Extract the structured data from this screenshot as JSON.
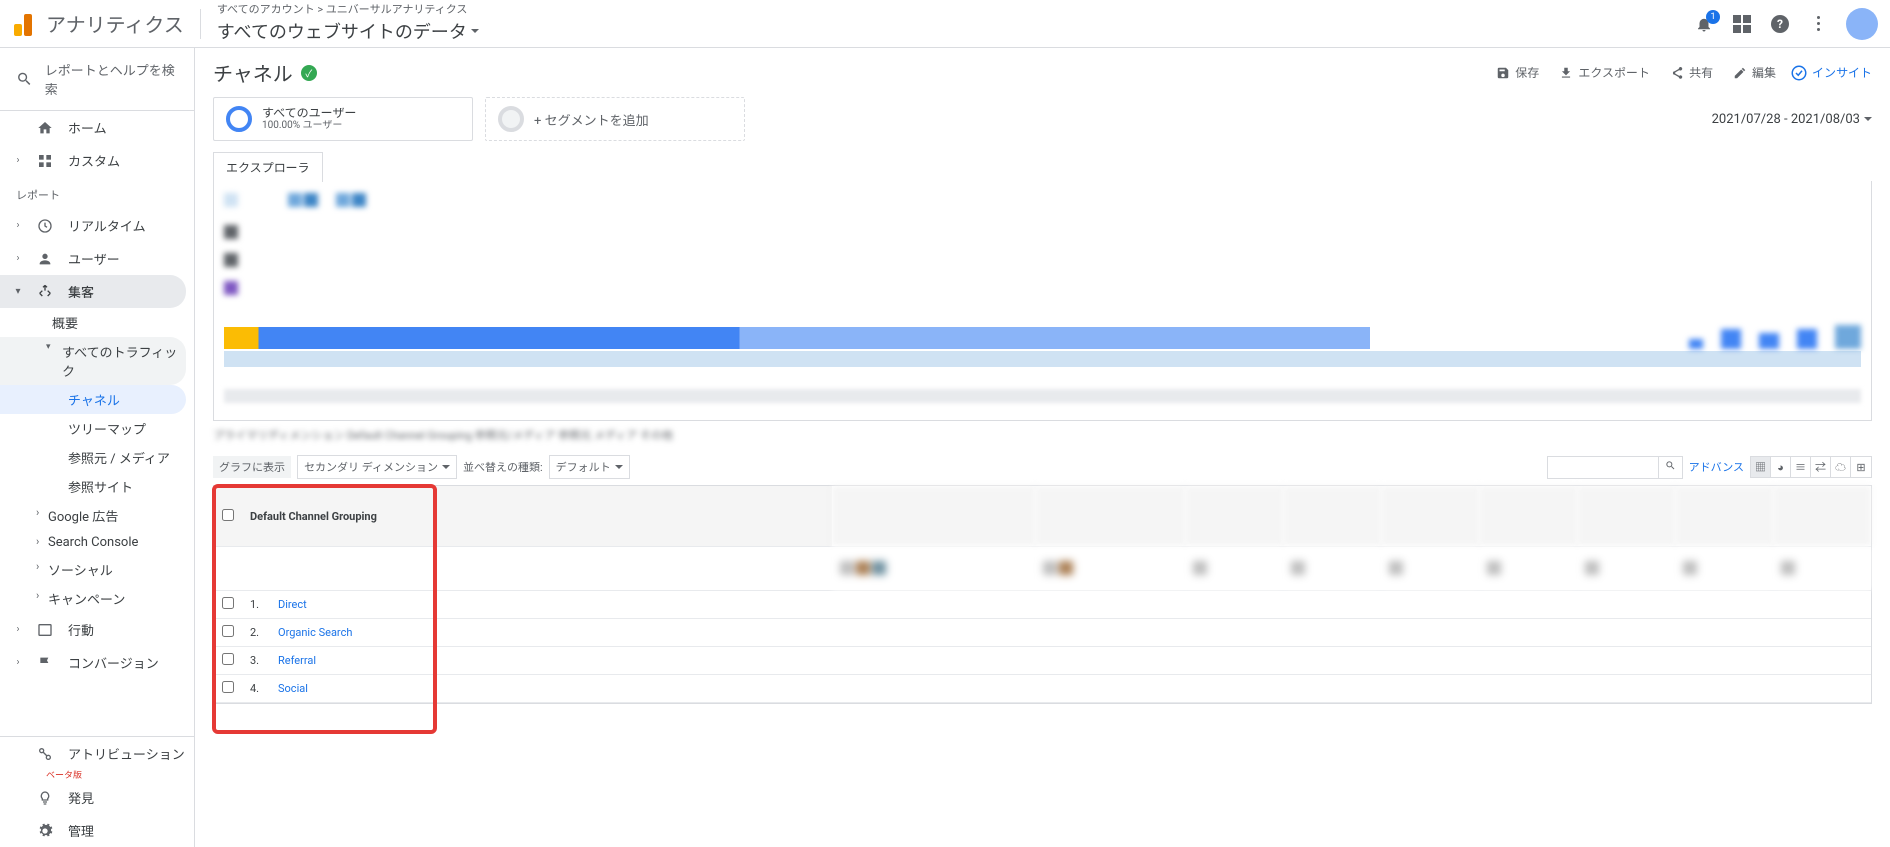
{
  "header": {
    "product": "アナリティクス",
    "crumbs": "すべてのアカウント > ユニバーサルアナリティクス",
    "title": "すべてのウェブサイトのデータ",
    "bell_count": "1"
  },
  "sidebar": {
    "search_placeholder": "レポートとヘルプを検索",
    "home": "ホーム",
    "custom": "カスタム",
    "section_label": "レポート",
    "realtime": "リアルタイム",
    "user": "ユーザー",
    "acquisition": "集客",
    "acq_overview": "概要",
    "acq_all_traffic": "すべてのトラフィック",
    "acq_channel": "チャネル",
    "acq_treemap": "ツリーマップ",
    "acq_source_medium": "参照元 / メディア",
    "acq_referrals": "参照サイト",
    "acq_google_ads": "Google 広告",
    "acq_search_console": "Search Console",
    "acq_social": "ソーシャル",
    "acq_campaigns": "キャンペーン",
    "behavior": "行動",
    "conversion": "コンバージョン",
    "attribution": "アトリビューション",
    "beta": "ベータ版",
    "discover": "発見",
    "admin": "管理"
  },
  "toolbar": {
    "title": "チャネル",
    "save": "保存",
    "export": "エクスポート",
    "share": "共有",
    "edit": "編集",
    "insight": "インサイト"
  },
  "segments": {
    "all_users": "すべてのユーザー",
    "all_users_sub": "100.00% ユーザー",
    "add_segment": "+ セグメントを追加"
  },
  "date_range": "2021/07/28 - 2021/08/03",
  "tabs": {
    "explorer": "エクスプローラ"
  },
  "controls": {
    "graph": "グラフに表示",
    "secondary_dim": "セカンダリ ディメンション",
    "sort_label": "並べ替えの種類:",
    "sort_value": "デフォルト",
    "advance": "アドバンス"
  },
  "table": {
    "dim_header": "Default Channel Grouping",
    "rows": [
      {
        "n": "1.",
        "label": "Direct"
      },
      {
        "n": "2.",
        "label": "Organic Search"
      },
      {
        "n": "3.",
        "label": "Referral"
      },
      {
        "n": "4.",
        "label": "Social"
      }
    ]
  }
}
